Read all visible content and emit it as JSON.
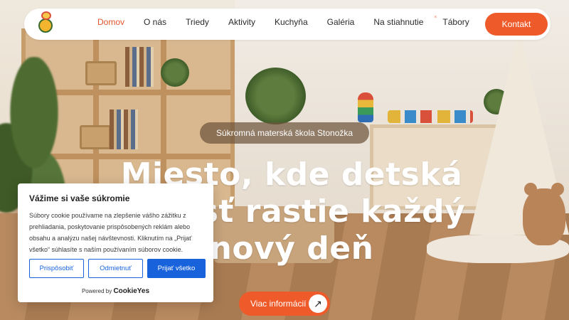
{
  "header": {
    "logo_alt": "Stonožka logo",
    "nav": [
      {
        "label": "Domov",
        "active": true
      },
      {
        "label": "O nás",
        "active": false
      },
      {
        "label": "Triedy",
        "active": false
      },
      {
        "label": "Aktivity",
        "active": false
      },
      {
        "label": "Kuchyňa",
        "active": false
      },
      {
        "label": "Galéria",
        "active": false
      },
      {
        "label": "Na stiahnutie",
        "active": false
      },
      {
        "label": "Tábory",
        "active": false
      }
    ],
    "nav_badge": "*",
    "contact_label": "Kontakt"
  },
  "hero": {
    "eyebrow": "Súkromná materská škola Stonožka",
    "headline": "Miesto, kde detská radosť rastie každý nový deň",
    "button_label": "Viac informácií",
    "button_icon": "arrow-up-right-icon"
  },
  "cookie_banner": {
    "title": "Vážime si vaše súkromie",
    "text": "Súbory cookie používame na zlepšenie vášho zážitku z prehliadania, poskytovanie prispôsobených reklám alebo obsahu a analýzu našej návštevnosti. Kliknutím na „Prijať všetko“ súhlasíte s naším používaním súborov cookie.",
    "customize_label": "Prispôsobiť",
    "reject_label": "Odmietnuť",
    "accept_label": "Prijať všetko",
    "powered_prefix": "Powered by",
    "powered_brand": "CookieYes"
  },
  "colors": {
    "accent": "#ef5a2a",
    "cookie_blue": "#1863dc",
    "active_nav": "#e2552d"
  }
}
